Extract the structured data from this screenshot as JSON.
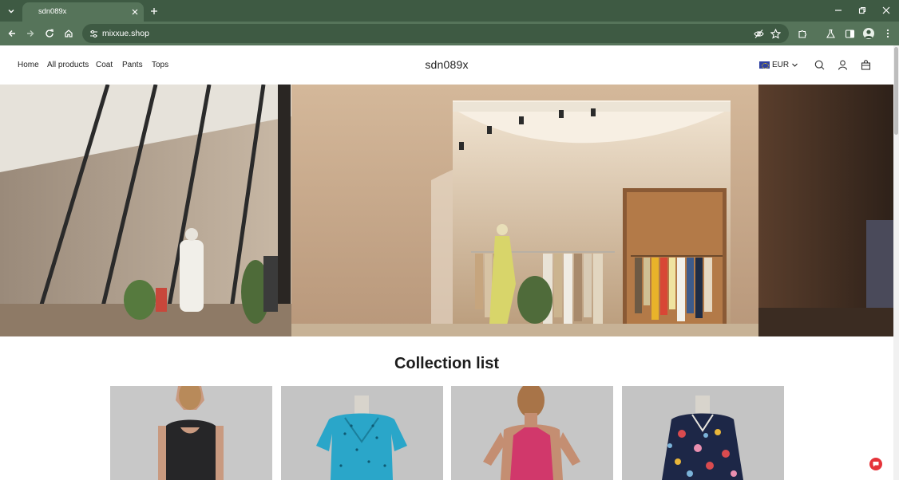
{
  "browser": {
    "tab_title": "sdn089x",
    "url": "mixxue.shop"
  },
  "site": {
    "nav": [
      {
        "label": "Home"
      },
      {
        "label": "All products"
      },
      {
        "label": "Coat"
      },
      {
        "label": "Pants"
      },
      {
        "label": "Tops"
      }
    ],
    "brand": "sdn089x",
    "currency": "EUR"
  },
  "collection": {
    "title": "Collection list",
    "cards": [
      {
        "subject": "black-dress"
      },
      {
        "subject": "teal-wrap-dress"
      },
      {
        "subject": "pink-swimsuit"
      },
      {
        "subject": "floral-shirt"
      }
    ]
  },
  "colors": {
    "chrome_dark": "#3e5a43",
    "chrome_light": "#56745a",
    "badge": "#e5343a"
  }
}
